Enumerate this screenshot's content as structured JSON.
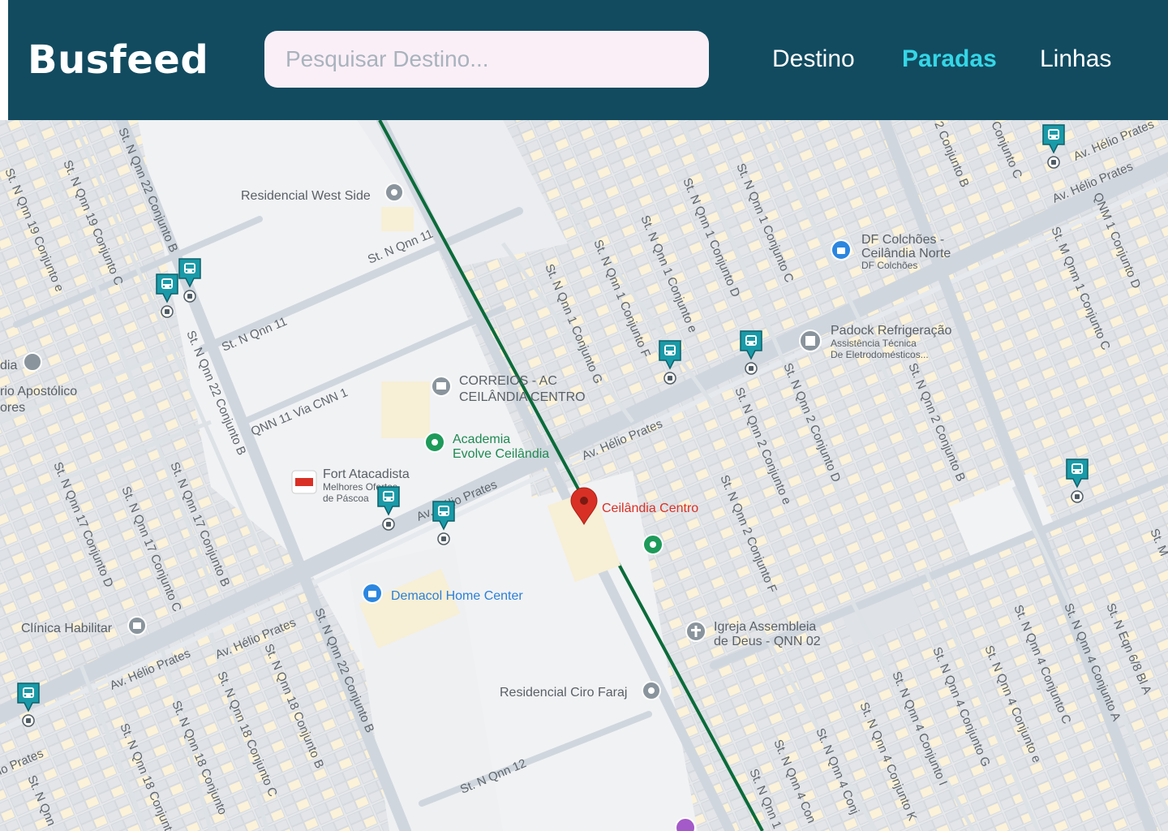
{
  "header": {
    "logo": "Busfeed",
    "search_placeholder": "Pesquisar Destino...",
    "nav": [
      {
        "label": "Destino",
        "active": false
      },
      {
        "label": "Paradas",
        "active": true
      },
      {
        "label": "Linhas",
        "active": false
      }
    ]
  },
  "colors": {
    "header_bg": "#124b60",
    "active_nav": "#35d6e6",
    "route_line": "#0b6b3a",
    "stop_marker": "#1a9aa8",
    "pin_red": "#d93025"
  },
  "map": {
    "labels": {
      "residencial_west_side": "Residencial West Side",
      "st_n_qnn_11_top": "St. N Qnn 11",
      "st_n_qnn_11": "St. N Qnn 11",
      "qnn_11_via_cnn_1": "QNN 11 Via CNN 1",
      "correios_1": "CORREIOS - AC",
      "correios_2": "CEILÂNDIA CENTRO",
      "academia_1": "Academia",
      "academia_2": "Evolve Ceilândia",
      "fort_1": "Fort Atacadista",
      "fort_2": "Melhores Ofertas",
      "fort_3": "de Páscoa",
      "av_helio_prates_1": "Av. Hélio Prates",
      "av_helio_prates_2": "Av. Hélio Prates",
      "av_helio_prates_3": "Av. Hélio Prates",
      "av_helio_prates_4": "Av. Hélio Prates",
      "av_helio_prates_5": "Av. Hélio Prates",
      "av_helio_prates_6": "Av. Hélio Prates",
      "av_helio_prates_7": "io Prates",
      "ceilandia_centro": "Ceilândia Centro",
      "demacol": "Demacol Home Center",
      "clinica": "Clínica Habilitar",
      "residencial_ciro": "Residencial Ciro Faraj",
      "st_n_qnn_12": "St. N Qnn 12",
      "igreja_1": "Igreja Assembleia",
      "igreja_2": "de Deus - QNN 02",
      "padock_1": "Padock Refrigeração",
      "padock_2": "Assistência Técnica",
      "padock_3": "De Eletrodomésticos...",
      "df_1": "DF Colchões -",
      "df_2": "Ceilândia Norte",
      "df_3": "DF Colchões",
      "apostolico_1": "rio Apostólico",
      "apostolico_2": "ores",
      "dia": "dia",
      "s1": "St. N Qnn 19 Conjunto e",
      "s2": "St. N Qnn 19 Conjunto C",
      "s3": "St. N Qnn 22 Conjunto B",
      "s4": "St. N Qnn 22 Conjunto B",
      "s5": "St. N Qnn 17 Conjunto D",
      "s6": "St. N Qnn 17 Conjunto C",
      "s7": "St. N Qnn 17 Conjunto B",
      "s8": "St. N Qnn 1 Conjunto G",
      "s9": "St. N Qnn 1 Conjunto F",
      "s10": "St. N Qnn 1 Conjunto e",
      "s11": "St. N Qnn 1 Conjunto D",
      "s12": "St. N Qnn 1 Conjunto C",
      "s13": "2 Conjunto B",
      "s14": "Conjunto C",
      "s15": "St. M Qnm 1 Conjunto C",
      "s16": "QNM 1 Conjunto D",
      "s17": "St. N Qnn 2 Conjunto e",
      "s18": "St. N Qnn 2 Conjunto D",
      "s19": "St. N Qnn 2 Conjunto B",
      "s20": "St. N Qnn 2 Conjunto F",
      "s21": "St. N Qnn 22 Conjunto B",
      "s22": "St. N Qnn 18 Conjunto B",
      "s23": "St. N Qnn 18 Conjunto C",
      "s24": "St. N Qnn 18 Conjunto",
      "s25": "St. N Qnn 18 Conjunto",
      "s26": "St. N Qnn 4 Conjunto I",
      "s27": "St. N Qnn 4 Conjunto K",
      "s28": "St. N Qnn 4 Conjunto G",
      "s29": "St. N Qnn 4 Conjunto e",
      "s30": "St. N Qnn 4 Conjunto C",
      "s31": "St. N Qnn 4 Conjunto A",
      "s32": "St. N Eqn 6/8 Bl A",
      "s33": "St. N Qnn",
      "s34": "St. N Qnn 4 Conj",
      "s35": "St. N Qnn 4 Con",
      "s36": "St. N Qnn 1",
      "s37": "St. N Qnn",
      "s38": "St. M"
    }
  }
}
